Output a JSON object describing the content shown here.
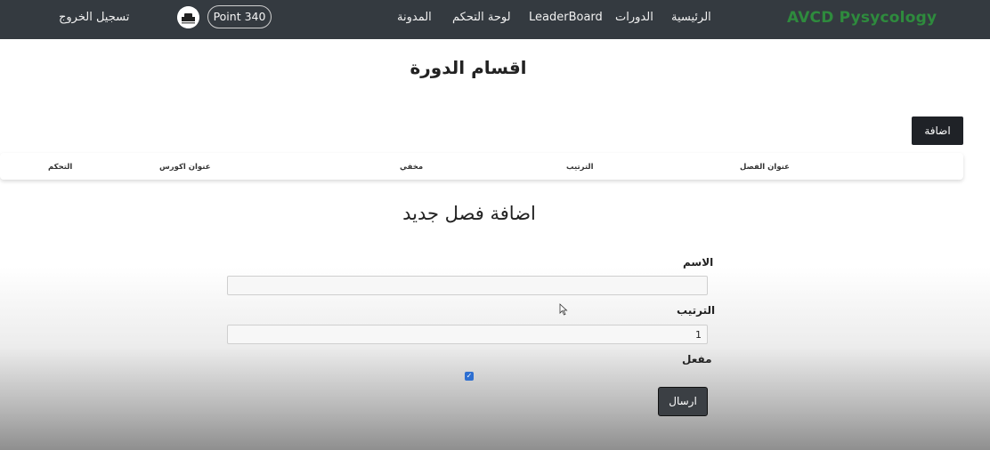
{
  "navbar": {
    "brand": "AVCD Pysycology",
    "links": [
      "الرئيسية",
      "الدورات",
      "LeaderBoard",
      "لوحة التحكم",
      "المدونة"
    ],
    "points": "Point 340",
    "logout": "تسجيل الخروج"
  },
  "page": {
    "title": "اقسام الدورة",
    "add_button": "اضافة"
  },
  "table": {
    "columns": [
      "عنوان الفصل",
      "الترتيب",
      "مخفي",
      "عنوان اكورس",
      "التحكم"
    ]
  },
  "form": {
    "title": "اضافة فصل جديد",
    "name_label": "الاسم",
    "name_value": "",
    "order_label": "الترتيب",
    "order_value": "1",
    "active_label": "مفعل",
    "active_checked": true,
    "submit": "ارسال"
  },
  "colors": {
    "navbar_bg": "#343a40",
    "brand": "#2e8b3d",
    "checkbox": "#2e6fd1"
  }
}
